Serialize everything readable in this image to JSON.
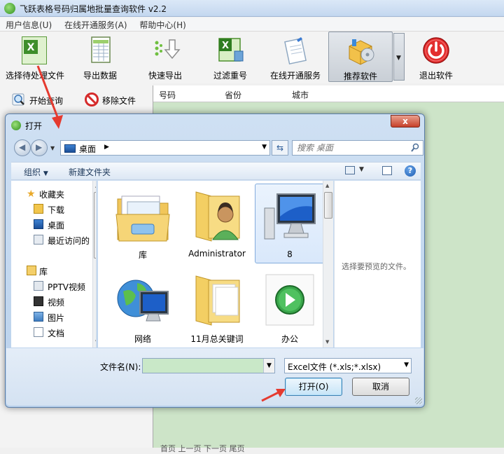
{
  "app": {
    "title": "飞跃表格号码归属地批量查询软件 v2.2"
  },
  "menu": [
    "用户信息(U)",
    "在线开通服务(A)",
    "帮助中心(H)"
  ],
  "toolbar": {
    "select_file": "选择待处理文件",
    "export_data": "导出数据",
    "quick_export": "快速导出",
    "filter_dup": "过滤重号",
    "online_service": "在线开通服务",
    "recommend": "推荐软件",
    "exit": "退出软件"
  },
  "subtoolbar": {
    "start_query": "开始查询",
    "remove_file": "移除文件"
  },
  "grid": {
    "columns": [
      "号码",
      "省份",
      "城市"
    ],
    "footer": "首页  上一页  下一页  尾页"
  },
  "dialog": {
    "title": "打开",
    "close": "x",
    "address": "桌面",
    "search_placeholder": "搜索 桌面",
    "organize": "组织",
    "new_folder": "新建文件夹",
    "nav": {
      "favorites": "收藏夹",
      "downloads": "下载",
      "desktop": "桌面",
      "recent": "最近访问的",
      "libraries": "库",
      "pptv": "PPTV视频",
      "video": "视频",
      "pictures": "图片",
      "documents": "文档"
    },
    "files": [
      "库",
      "Administrator",
      "8",
      "网络",
      "11月总关键词",
      "办公"
    ],
    "preview_text": "选择要预览的文件。",
    "filename_label": "文件名(N):",
    "filename_value": "",
    "file_type": "Excel文件 (*.xls;*.xlsx)",
    "open_button": "打开(O)",
    "cancel_button": "取消"
  },
  "colors": {
    "grid_bg": "#cde4c8",
    "arrow_red": "#e53a2f",
    "exit_red": "#e32d2d"
  }
}
